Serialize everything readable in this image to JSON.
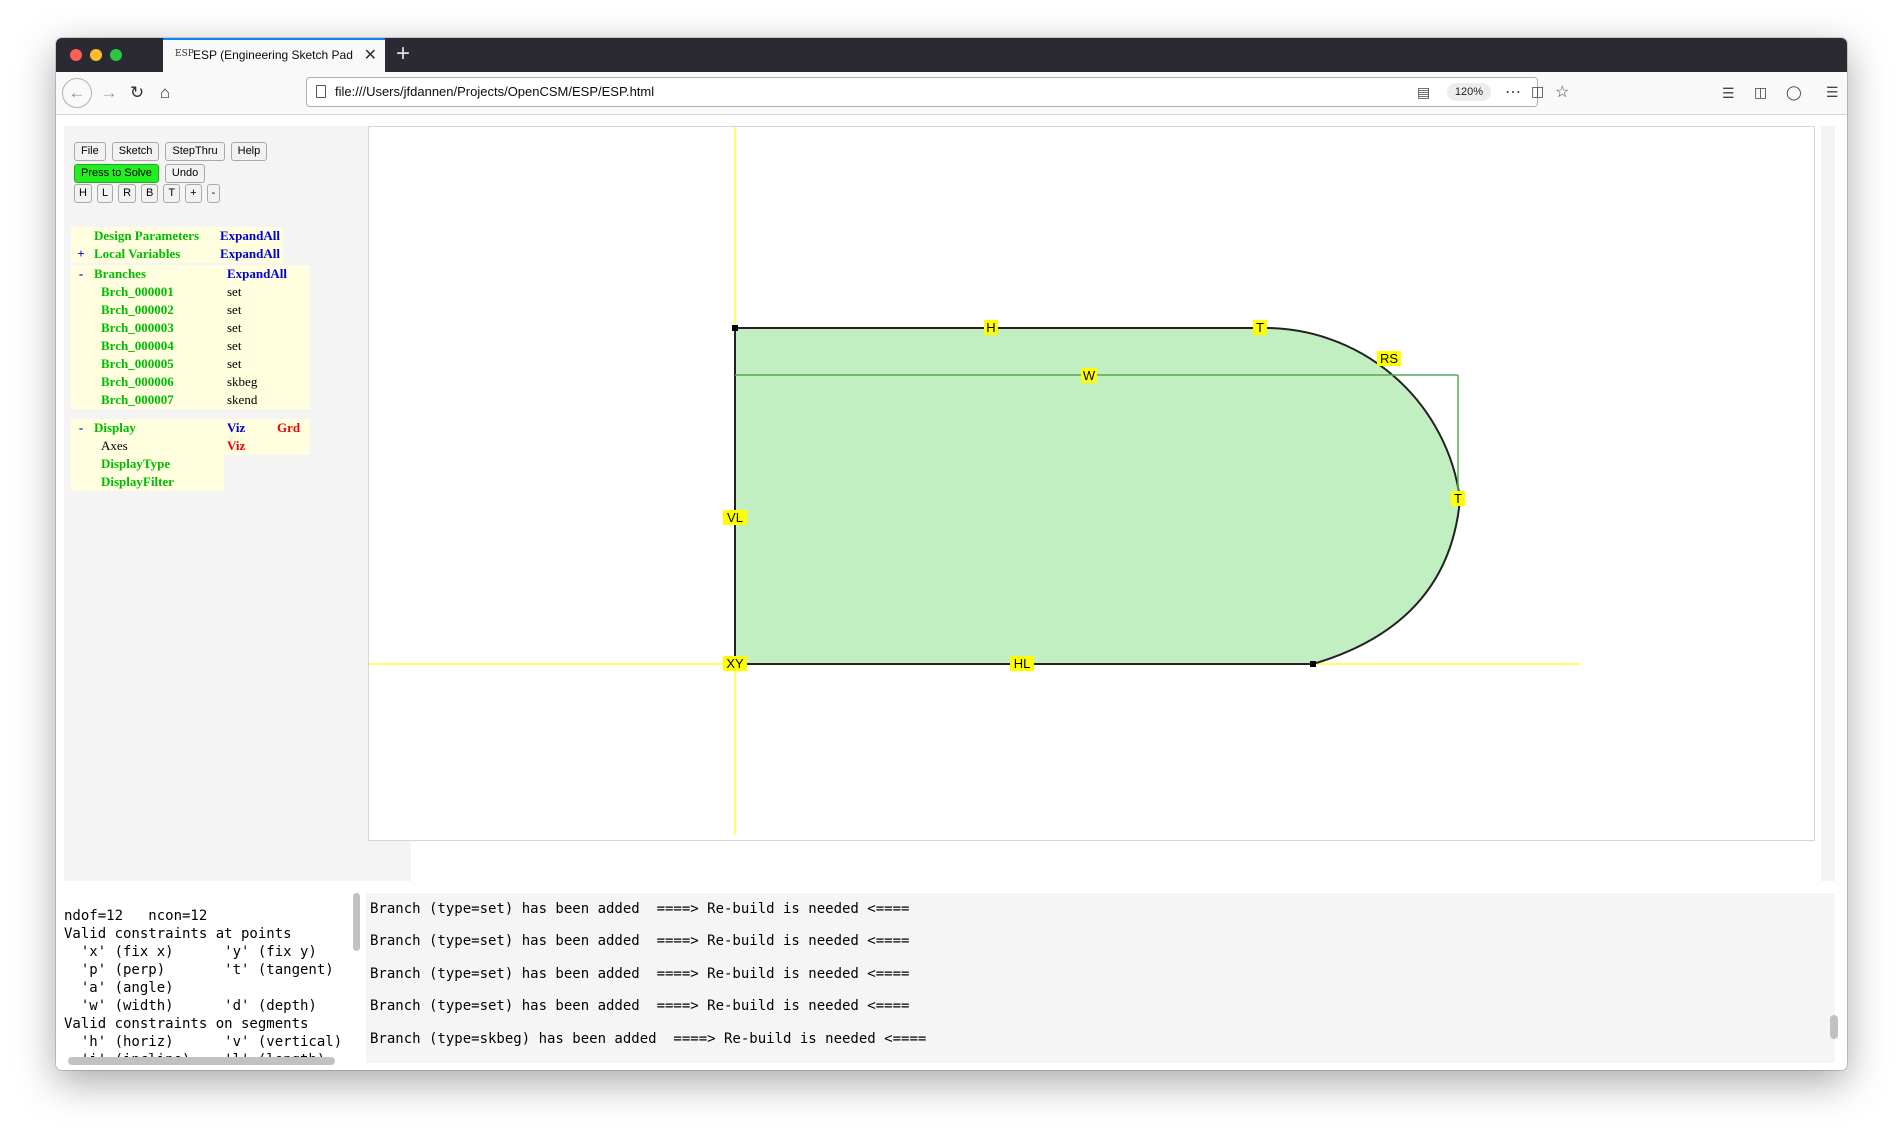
{
  "browser": {
    "tab_title": "ESP (Engineering Sketch Pad, V",
    "tab_favicon": "ESP",
    "url": "file:///Users/jfdannen/Projects/OpenCSM/ESP/ESP.html",
    "zoom": "120%",
    "new_tab": "+",
    "close": "✕"
  },
  "toolbar": {
    "file": "File",
    "sketch": "Sketch",
    "stepthru": "StepThru",
    "help": "Help",
    "solve": "Press to Solve",
    "undo": "Undo",
    "view_buttons": [
      "H",
      "L",
      "R",
      "B",
      "T",
      "+",
      "-"
    ]
  },
  "tree": {
    "design_params": {
      "label": "Design Parameters",
      "action": "ExpandAll"
    },
    "local_vars": {
      "toggle": "+",
      "label": "Local Variables",
      "action": "ExpandAll"
    },
    "branches": {
      "toggle": "-",
      "label": "Branches",
      "action": "ExpandAll",
      "items": [
        {
          "name": "Brch_000001",
          "type": "set"
        },
        {
          "name": "Brch_000002",
          "type": "set"
        },
        {
          "name": "Brch_000003",
          "type": "set"
        },
        {
          "name": "Brch_000004",
          "type": "set"
        },
        {
          "name": "Brch_000005",
          "type": "set"
        },
        {
          "name": "Brch_000006",
          "type": "skbeg"
        },
        {
          "name": "Brch_000007",
          "type": "skend"
        }
      ]
    },
    "display": {
      "toggle": "-",
      "label": "Display",
      "viz": "Viz",
      "grd": "Grd",
      "axes": "Axes",
      "axes_viz": "Viz",
      "display_type": "DisplayType",
      "display_filter": "DisplayFilter"
    }
  },
  "sketch": {
    "constraint_labels": {
      "h": "H",
      "t_top": "T",
      "rs": "RS",
      "w": "W",
      "t_right": "T",
      "vl": "VL",
      "xy": "XY",
      "hl": "HL"
    },
    "colors": {
      "fill": "#c2efc2",
      "outline": "#222222",
      "axis": "#ffff33",
      "label_bg": "#ffff00",
      "dimension": "#55aa55"
    }
  },
  "solver_text": "ndof=12   ncon=12\nValid constraints at points\n  'x' (fix x)      'y' (fix y)\n  'p' (perp)       't' (tangent)\n  'a' (angle)\n  'w' (width)      'd' (depth)\nValid constraints on segments\n  'h' (horiz)      'v' (vertical)\n  'i' (incline)    'l' (length)",
  "messages": [
    "Branch (type=set) has been added  ====> Re-build is needed <====",
    "Branch (type=set) has been added  ====> Re-build is needed <====",
    "Branch (type=set) has been added  ====> Re-build is needed <====",
    "Branch (type=set) has been added  ====> Re-build is needed <====",
    "Branch (type=skbeg) has been added  ====> Re-build is needed <===="
  ]
}
